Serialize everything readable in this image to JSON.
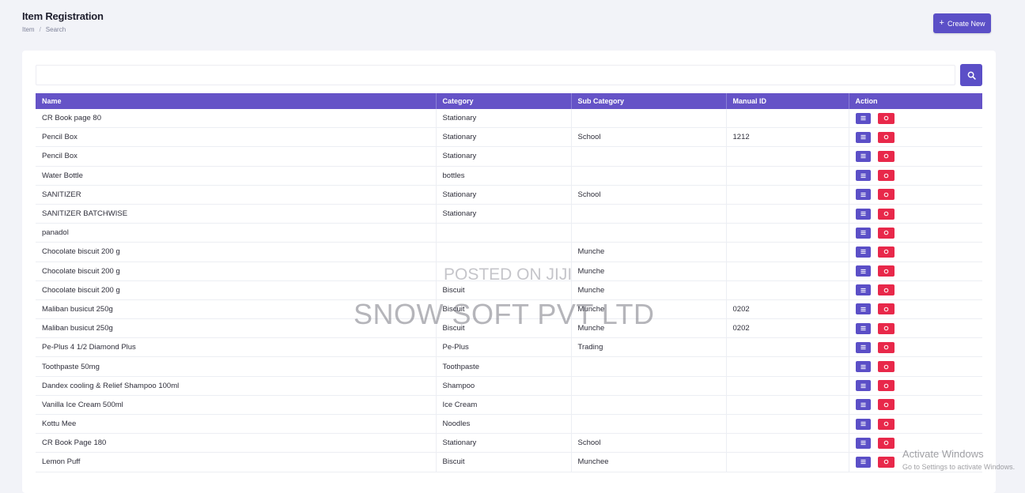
{
  "header": {
    "title": "Item Registration",
    "breadcrumb": [
      "Item",
      "Search"
    ],
    "breadcrumb_separator": "/",
    "create_button_icon": "plus-icon",
    "create_button_label": "Create New"
  },
  "search": {
    "value": "",
    "button_icon": "search-icon"
  },
  "table": {
    "columns": [
      "Name",
      "Category",
      "Sub Category",
      "Manual ID",
      "Action"
    ],
    "rows": [
      [
        "CR Book page 80",
        "Stationary",
        "",
        ""
      ],
      [
        "Pencil Box",
        "Stationary",
        "School",
        "1212"
      ],
      [
        "Pencil Box",
        "Stationary",
        "",
        ""
      ],
      [
        "Water Bottle",
        "bottles",
        "",
        ""
      ],
      [
        "SANITIZER",
        "Stationary",
        "School",
        ""
      ],
      [
        "SANITIZER BATCHWISE",
        "Stationary",
        "",
        ""
      ],
      [
        "panadol",
        "",
        "",
        ""
      ],
      [
        "Chocolate biscuit 200 g",
        "",
        "Munche",
        ""
      ],
      [
        "Chocolate biscuit 200 g",
        "",
        "Munche",
        ""
      ],
      [
        "Chocolate biscuit 200 g",
        "Biscuit",
        "Munche",
        ""
      ],
      [
        "Maliban busicut 250g",
        "Biscuit",
        "Munche",
        "0202"
      ],
      [
        "Maliban busicut 250g",
        "Biscuit",
        "Munche",
        "0202"
      ],
      [
        "Pe-Plus 4 1/2 Diamond Plus",
        "Pe-Plus",
        "Trading",
        ""
      ],
      [
        "Toothpaste 50mg",
        "Toothpaste",
        "",
        ""
      ],
      [
        "Dandex cooling & Relief Shampoo 100ml",
        "Shampoo",
        "",
        ""
      ],
      [
        "Vanilla Ice Cream 500ml",
        "Ice Cream",
        "",
        ""
      ],
      [
        "Kottu Mee",
        "Noodles",
        "",
        ""
      ],
      [
        "CR Book Page 180",
        "Stationary",
        "School",
        ""
      ],
      [
        "Lemon Puff",
        "Biscuit",
        "Munchee",
        ""
      ]
    ],
    "edit_icon": "edit-icon",
    "delete_icon": "delete-icon"
  },
  "watermark": {
    "posted": "POSTED ON JIJI",
    "company": "SNOW SOFT PVT LTD"
  },
  "windows_notice": {
    "title": "Activate Windows",
    "subtitle": "Go to Settings to activate Windows."
  },
  "colors": {
    "accent": "#5b4fc7",
    "table_header": "#6553c7",
    "delete": "#e8284a",
    "background": "#f2f3f8"
  }
}
